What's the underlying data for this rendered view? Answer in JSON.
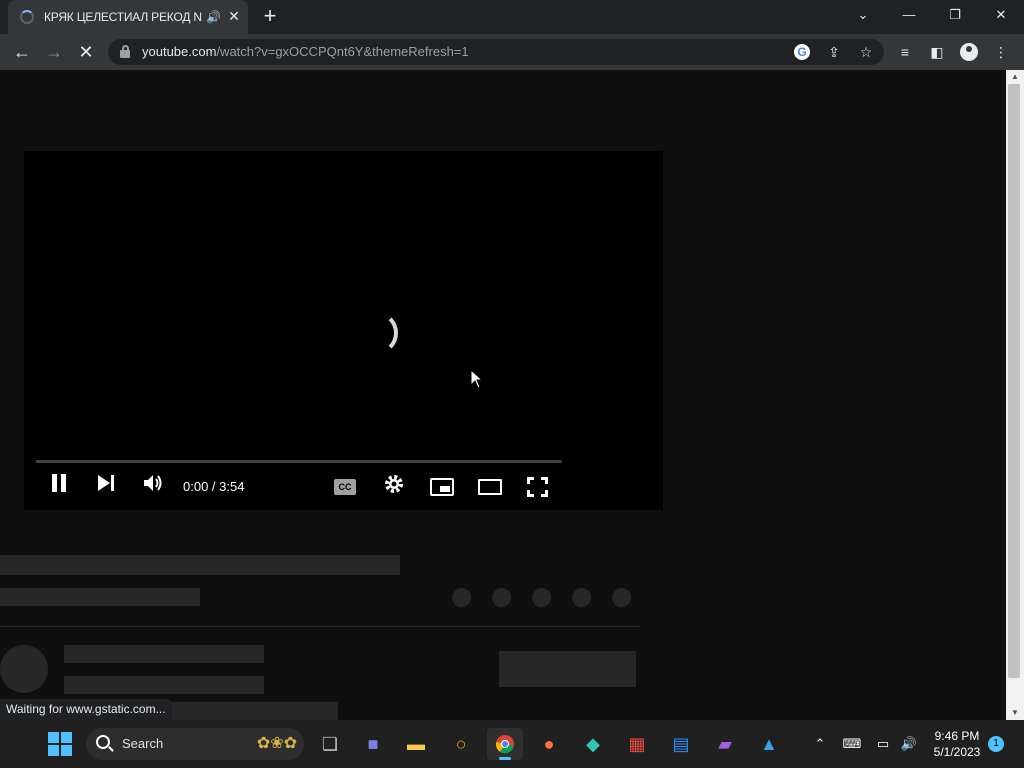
{
  "browser": {
    "tab_title": "КРЯК ЦЕЛЕСТИАЛ РЕКОД N",
    "url_host": "youtube.com",
    "url_path": "/watch?v=gxOCCPQnt6Y&themeRefresh=1",
    "new_tab_label": "+",
    "close_glyph": "✕",
    "status_text": "Waiting for www.gstatic.com..."
  },
  "player": {
    "time_display": "0:00 / 3:54",
    "cc_label": "CC"
  },
  "taskbar": {
    "search_label": "Search",
    "clock_time": "9:46 PM",
    "clock_date": "5/1/2023",
    "notification_count": "1"
  },
  "colors": {
    "page_bg": "#0f0f0f",
    "skeleton": "#272727",
    "accent": "#4cc2ff"
  }
}
